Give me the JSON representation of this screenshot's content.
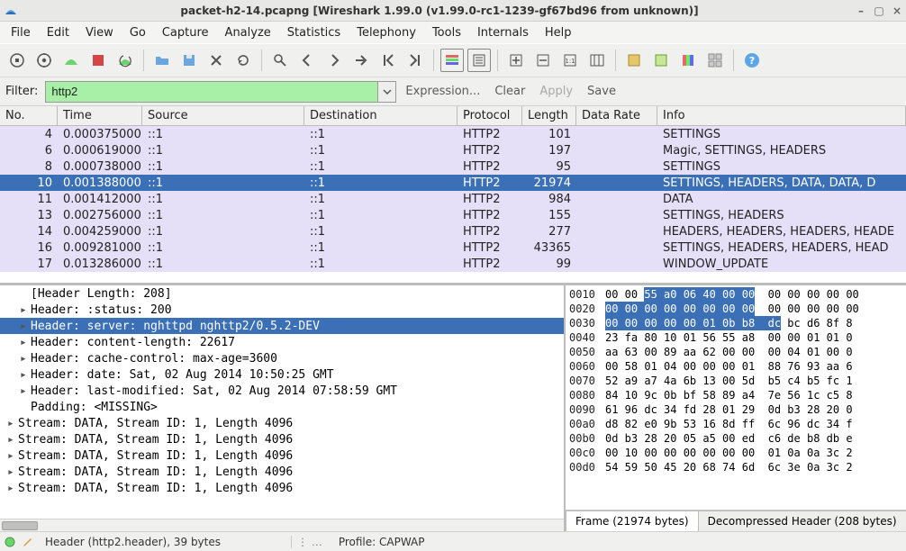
{
  "title": "packet-h2-14.pcapng   [Wireshark 1.99.0 (v1.99.0-rc1-1239-gf67bd96 from unknown)]",
  "menus": [
    "File",
    "Edit",
    "View",
    "Go",
    "Capture",
    "Analyze",
    "Statistics",
    "Telephony",
    "Tools",
    "Internals",
    "Help"
  ],
  "filter": {
    "label": "Filter:",
    "value": "http2",
    "expression": "Expression...",
    "clear": "Clear",
    "apply": "Apply",
    "save": "Save"
  },
  "columns": {
    "no": "No.",
    "time": "Time",
    "src": "Source",
    "dst": "Destination",
    "proto": "Protocol",
    "len": "Length",
    "rate": "Data Rate",
    "info": "Info"
  },
  "packets": [
    {
      "no": "4",
      "time": "0.000375000",
      "src": "::1",
      "dst": "::1",
      "proto": "HTTP2",
      "len": "101",
      "rate": "",
      "info": "SETTINGS",
      "cls": "lav"
    },
    {
      "no": "6",
      "time": "0.000619000",
      "src": "::1",
      "dst": "::1",
      "proto": "HTTP2",
      "len": "197",
      "rate": "",
      "info": "Magic, SETTINGS, HEADERS",
      "cls": "lav"
    },
    {
      "no": "8",
      "time": "0.000738000",
      "src": "::1",
      "dst": "::1",
      "proto": "HTTP2",
      "len": "95",
      "rate": "",
      "info": "SETTINGS",
      "cls": "lav"
    },
    {
      "no": "10",
      "time": "0.001388000",
      "src": "::1",
      "dst": "::1",
      "proto": "HTTP2",
      "len": "21974",
      "rate": "",
      "info": "SETTINGS, HEADERS, DATA, DATA, D",
      "cls": "sel"
    },
    {
      "no": "11",
      "time": "0.001412000",
      "src": "::1",
      "dst": "::1",
      "proto": "HTTP2",
      "len": "984",
      "rate": "",
      "info": "DATA",
      "cls": "lav"
    },
    {
      "no": "13",
      "time": "0.002756000",
      "src": "::1",
      "dst": "::1",
      "proto": "HTTP2",
      "len": "155",
      "rate": "",
      "info": "SETTINGS, HEADERS",
      "cls": "lav"
    },
    {
      "no": "14",
      "time": "0.004259000",
      "src": "::1",
      "dst": "::1",
      "proto": "HTTP2",
      "len": "277",
      "rate": "",
      "info": "HEADERS, HEADERS, HEADERS, HEADE",
      "cls": "lav"
    },
    {
      "no": "16",
      "time": "0.009281000",
      "src": "::1",
      "dst": "::1",
      "proto": "HTTP2",
      "len": "43365",
      "rate": "",
      "info": "SETTINGS, HEADERS, HEADERS, HEAD",
      "cls": "lav"
    },
    {
      "no": "17",
      "time": "0.013286000",
      "src": "::1",
      "dst": "::1",
      "proto": "HTTP2",
      "len": "99",
      "rate": "",
      "info": "WINDOW_UPDATE",
      "cls": "lav"
    }
  ],
  "tree": [
    {
      "text": "[Header Length: 208]",
      "ind": 1,
      "exp": ""
    },
    {
      "text": "Header: :status: 200",
      "ind": 1,
      "exp": "▸"
    },
    {
      "text": "Header: server: nghttpd nghttp2/0.5.2-DEV",
      "ind": 1,
      "exp": "▸",
      "sel": true
    },
    {
      "text": "Header: content-length: 22617",
      "ind": 1,
      "exp": "▸"
    },
    {
      "text": "Header: cache-control: max-age=3600",
      "ind": 1,
      "exp": "▸"
    },
    {
      "text": "Header: date: Sat, 02 Aug 2014 10:50:25 GMT",
      "ind": 1,
      "exp": "▸"
    },
    {
      "text": "Header: last-modified: Sat, 02 Aug 2014 07:58:59 GMT",
      "ind": 1,
      "exp": "▸"
    },
    {
      "text": "Padding: <MISSING>",
      "ind": 1,
      "exp": ""
    },
    {
      "text": "Stream: DATA, Stream ID: 1, Length 4096",
      "ind": 0,
      "exp": "▸"
    },
    {
      "text": "Stream: DATA, Stream ID: 1, Length 4096",
      "ind": 0,
      "exp": "▸"
    },
    {
      "text": "Stream: DATA, Stream ID: 1, Length 4096",
      "ind": 0,
      "exp": "▸"
    },
    {
      "text": "Stream: DATA, Stream ID: 1, Length 4096",
      "ind": 0,
      "exp": "▸"
    },
    {
      "text": "Stream: DATA, Stream ID: 1, Length 4096",
      "ind": 0,
      "exp": "▸"
    }
  ],
  "hex": [
    {
      "off": "0010",
      "l": "00 00 ",
      "hi": "55 a0 06 40 00 00",
      "r": "  00 00 00 00 00"
    },
    {
      "off": "0020",
      "l": "",
      "hi": "00 00 00 00 00 00 00 00",
      "r": "  00 00 00 00 00"
    },
    {
      "off": "0030",
      "l": "",
      "hi": "00 00 00 00 00 01 0b b8  dc",
      "r": " bc d6 8f 8"
    },
    {
      "off": "0040",
      "l": "23 fa 80 10 01 56 55 a8",
      "hi": "",
      "r": "  00 00 01 01 0"
    },
    {
      "off": "0050",
      "l": "aa 63 00 89 aa 62 00 00",
      "hi": "",
      "r": "  00 04 01 00 0"
    },
    {
      "off": "0060",
      "l": "00 58 01 04 00 00 00 01",
      "hi": "",
      "r": "  88 76 93 aa 6"
    },
    {
      "off": "0070",
      "l": "52 a9 a7 4a 6b 13 00 5d",
      "hi": "",
      "r": "  b5 c4 b5 fc 1"
    },
    {
      "off": "0080",
      "l": "84 10 9c 0b bf 58 89 a4",
      "hi": "",
      "r": "  7e 56 1c c5 8"
    },
    {
      "off": "0090",
      "l": "61 96 dc 34 fd 28 01 29",
      "hi": "",
      "r": "  0d b3 28 20 0"
    },
    {
      "off": "00a0",
      "l": "d8 82 e0 9b 53 16 8d ff",
      "hi": "",
      "r": "  6c 96 dc 34 f"
    },
    {
      "off": "00b0",
      "l": "0d b3 28 20 05 a5 00 ed",
      "hi": "",
      "r": "  c6 de b8 db e"
    },
    {
      "off": "00c0",
      "l": "00 10 00 00 00 00 00 00",
      "hi": "",
      "r": "  01 0a 0a 3c 2"
    },
    {
      "off": "00d0",
      "l": "54 59 50 45 20 68 74 6d",
      "hi": "",
      "r": "  6c 3e 0a 3c 2"
    }
  ],
  "hex_tabs": {
    "frame": "Frame (21974 bytes)",
    "decomp": "Decompressed Header (208 bytes)"
  },
  "status": {
    "left": "Header (http2.header), 39 bytes",
    "profile": "Profile: CAPWAP"
  }
}
